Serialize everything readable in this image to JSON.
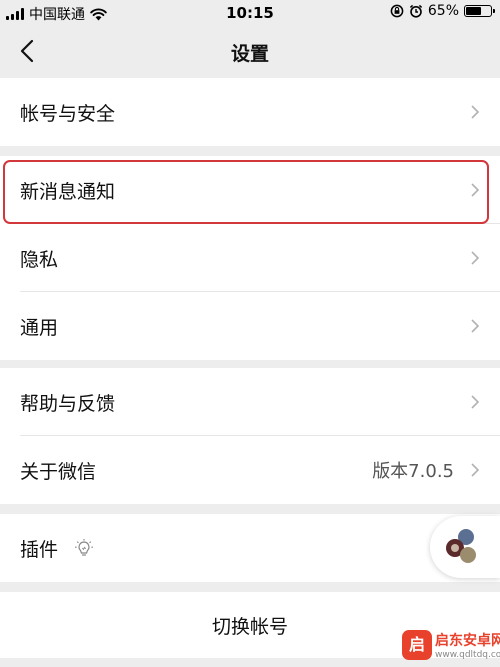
{
  "status_bar": {
    "carrier": "中国联通",
    "time": "10:15",
    "battery_percent": "65%",
    "battery_level": 0.65
  },
  "nav": {
    "title": "设置"
  },
  "groups": [
    {
      "items": [
        {
          "label": "帐号与安全"
        }
      ]
    },
    {
      "items": [
        {
          "label": "新消息通知",
          "highlighted": true
        },
        {
          "label": "隐私"
        },
        {
          "label": "通用"
        }
      ]
    },
    {
      "items": [
        {
          "label": "帮助与反馈"
        },
        {
          "label": "关于微信",
          "value": "版本7.0.5"
        }
      ]
    },
    {
      "items": [
        {
          "label": "插件",
          "icon": "lightbulb-icon"
        }
      ]
    }
  ],
  "switch_account": {
    "label": "切换帐号"
  },
  "colors": {
    "background": "#ededed",
    "highlight": "#d2373b",
    "divider": "#e6e6e6"
  },
  "watermark": {
    "logo_char": "启",
    "title": "启东安卓网",
    "url": "www.qdltdq.com"
  }
}
